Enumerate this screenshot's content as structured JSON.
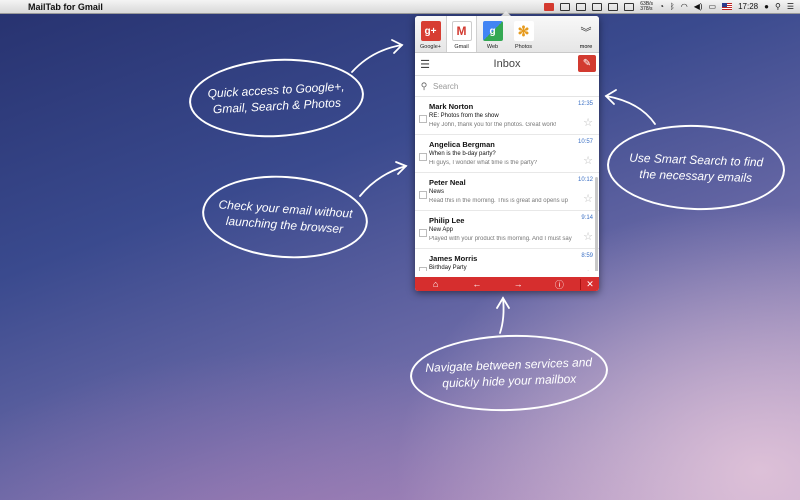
{
  "menubar": {
    "app_name": "MailTab for Gmail",
    "netspeed_up": "63B/s",
    "netspeed_down": "378/s",
    "clock": "17:28"
  },
  "services": [
    {
      "label": "Google+",
      "icon": "google-plus-icon",
      "glyph": "g+"
    },
    {
      "label": "Gmail",
      "icon": "gmail-icon",
      "glyph": "M"
    },
    {
      "label": "Web",
      "icon": "google-search-icon",
      "glyph": "g"
    },
    {
      "label": "Photos",
      "icon": "photos-icon",
      "glyph": "✻"
    }
  ],
  "more_label": "more",
  "inbox_title": "Inbox",
  "search_placeholder": "Search",
  "emails": [
    {
      "from": "Mark Norton",
      "time": "12:35",
      "subject": "RE: Photos from the show",
      "preview": "Hey John, thank you for the photos. Great work!"
    },
    {
      "from": "Angelica Bergman",
      "time": "10:57",
      "subject": "When is the b-day party?",
      "preview": "Hi guys, I wonder what time is the party?"
    },
    {
      "from": "Peter Neal",
      "time": "10:12",
      "subject": "News",
      "preview": "Read this in the morning. This is great and opens up"
    },
    {
      "from": "Philip Lee",
      "time": "9:14",
      "subject": "New App",
      "preview": "Played with your product this morning. And I must say"
    },
    {
      "from": "James Morris",
      "time": "8:59",
      "subject": "Birthday Party",
      "preview": ""
    }
  ],
  "callouts": {
    "quick_access": "Quick access to Google+, Gmail, Search & Photos",
    "check_email": "Check your email without launching the browser",
    "smart_search": "Use Smart Search to find the necessary emails",
    "navigate": "Navigate between services and quickly hide your mailbox"
  },
  "colors": {
    "accent_red": "#d62e2e",
    "link_blue": "#3a6fc4"
  }
}
